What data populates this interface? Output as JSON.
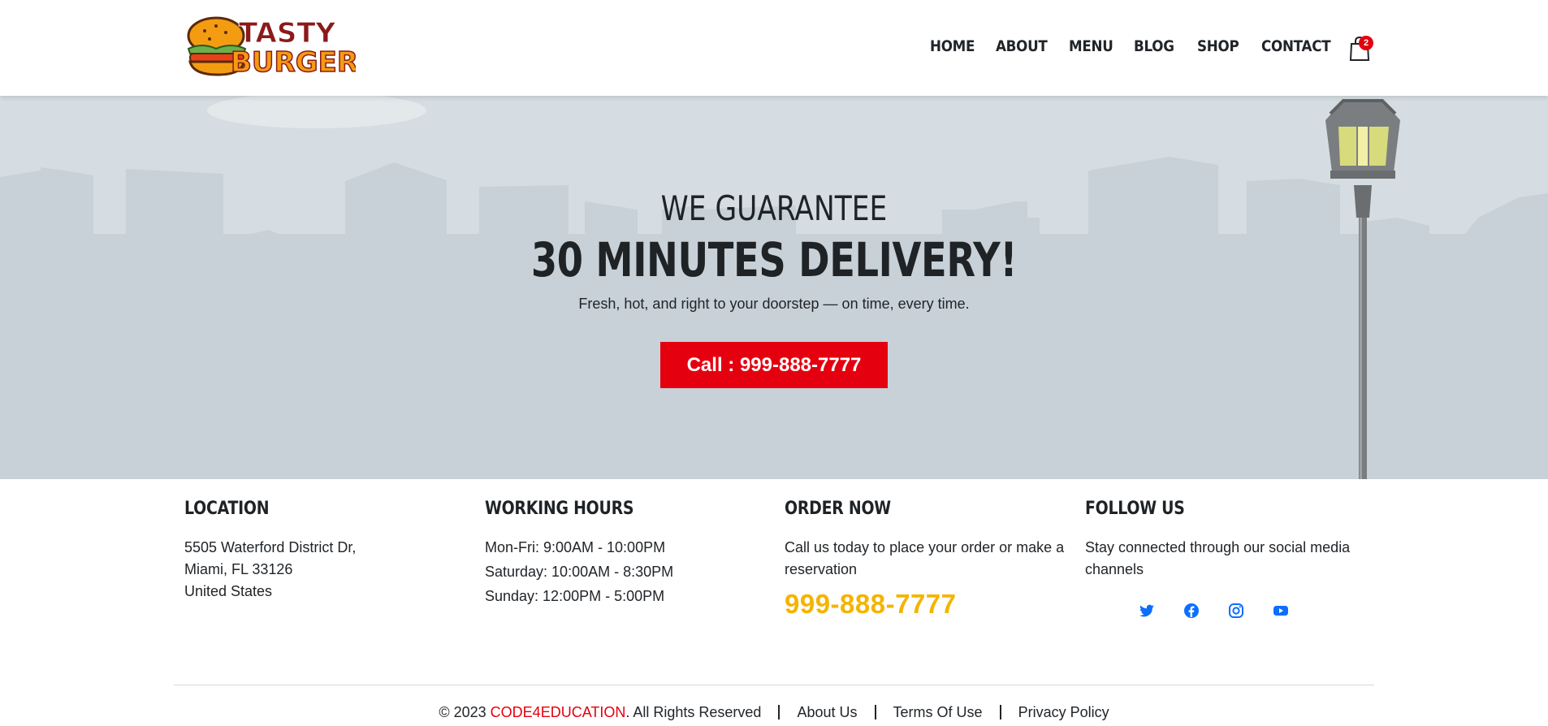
{
  "logo": {
    "line1": "TASTY",
    "line2": "BURGER"
  },
  "nav": {
    "items": [
      "HOME",
      "ABOUT",
      "MENU",
      "BLOG",
      "SHOP",
      "CONTACT"
    ],
    "cart_count": "2"
  },
  "hero": {
    "kicker": "WE GUARANTEE",
    "title": "30 MINUTES DELIVERY!",
    "subtitle": "Fresh, hot, and right to your doorstep — on time, every time.",
    "cta": "Call : 999-888-7777"
  },
  "footer": {
    "location": {
      "title": "LOCATION",
      "line1": "5505 Waterford District Dr,",
      "line2": "Miami, FL 33126",
      "line3": "United States"
    },
    "hours": {
      "title": "WORKING HOURS",
      "lines": [
        "Mon-Fri: 9:00AM - 10:00PM",
        "Saturday: 10:00AM - 8:30PM",
        "Sunday: 12:00PM - 5:00PM"
      ]
    },
    "order": {
      "title": "ORDER NOW",
      "text": "Call us today to place your order or make a reservation",
      "phone": "999-888-7777"
    },
    "follow": {
      "title": "FOLLOW US",
      "text": "Stay connected through our social media channels",
      "icons": [
        "twitter-icon",
        "facebook-icon",
        "instagram-icon",
        "youtube-icon"
      ]
    }
  },
  "bottom": {
    "copyright_prefix": "© 2023 ",
    "brand": "CODE4EDUCATION",
    "copyright_suffix": ". All Rights Reserved",
    "links": [
      "About Us",
      "Terms Of Use",
      "Privacy Policy"
    ]
  },
  "colors": {
    "accent_red": "#e4000f",
    "accent_yellow": "#f4b400",
    "social_blue": "#0d6efd",
    "hero_bg": "#d5dde2"
  }
}
